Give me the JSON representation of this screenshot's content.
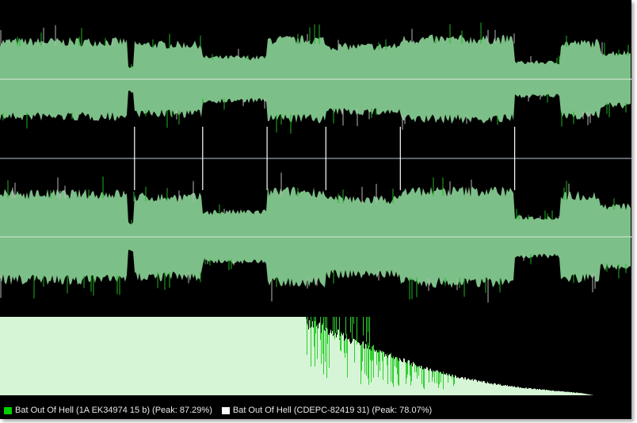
{
  "colors": {
    "background": "#000000",
    "wave_fill": "#7dbf88",
    "wave_green_spike": "#1fb51f",
    "wave_gray_spike": "#b8b8b8",
    "center_line": "#b9dcbf",
    "divider_line": "#7c8490",
    "marker_line": "#ffffff",
    "spectrum_light": "#d6f5d6",
    "spectrum_green": "#2fcf2f"
  },
  "waveform": {
    "segments": [
      {
        "start": 0.0,
        "end": 0.203,
        "level": 0.78
      },
      {
        "start": 0.203,
        "end": 0.212,
        "level": 0.25
      },
      {
        "start": 0.212,
        "end": 0.321,
        "level": 0.72
      },
      {
        "start": 0.321,
        "end": 0.423,
        "level": 0.45
      },
      {
        "start": 0.423,
        "end": 0.516,
        "level": 0.82
      },
      {
        "start": 0.516,
        "end": 0.634,
        "level": 0.68
      },
      {
        "start": 0.634,
        "end": 0.815,
        "level": 0.83
      },
      {
        "start": 0.815,
        "end": 0.888,
        "level": 0.35
      },
      {
        "start": 0.888,
        "end": 0.95,
        "level": 0.75
      },
      {
        "start": 0.95,
        "end": 1.0,
        "level": 0.55
      }
    ],
    "markers": [
      0.213,
      0.321,
      0.423,
      0.516,
      0.634,
      0.815
    ]
  },
  "spectrum": {
    "solid_until": 0.485,
    "tail": [
      {
        "f": 0.485,
        "level": 1.0
      },
      {
        "f": 0.53,
        "level": 0.86
      },
      {
        "f": 0.58,
        "level": 0.68
      },
      {
        "f": 0.63,
        "level": 0.5
      },
      {
        "f": 0.68,
        "level": 0.35
      },
      {
        "f": 0.73,
        "level": 0.24
      },
      {
        "f": 0.78,
        "level": 0.16
      },
      {
        "f": 0.83,
        "level": 0.1
      },
      {
        "f": 0.88,
        "level": 0.06
      },
      {
        "f": 0.92,
        "level": 0.03
      },
      {
        "f": 0.94,
        "level": 0.0
      }
    ]
  },
  "legend": [
    {
      "label": "Bat Out Of Hell (1A EK34974 15 b) (Peak: 87.29%)",
      "color": "#00d000"
    },
    {
      "label": "Bat Out Of Hell (CDEPC-82419 31) (Peak: 78.07%)",
      "color": "#ffffff"
    }
  ]
}
